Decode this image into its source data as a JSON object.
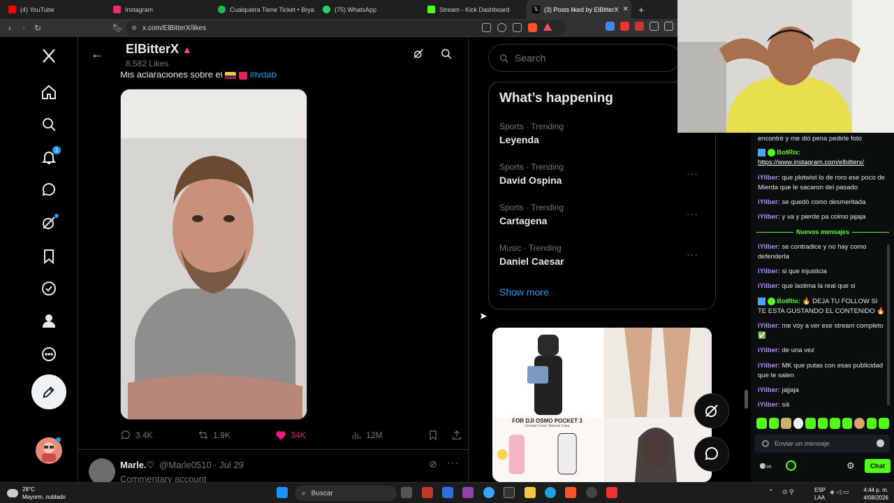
{
  "browser": {
    "tabs": [
      {
        "title": "(4) YouTube",
        "color": "#ff0000"
      },
      {
        "title": "Instagram",
        "color": "#e1306c"
      },
      {
        "title": "Cualquiera Tiene Ticket • Brya",
        "color": "#1db954"
      },
      {
        "title": "(75) WhatsApp",
        "color": "#25d366"
      },
      {
        "title": "Stream - Kick Dashboard",
        "color": "#53fc18"
      },
      {
        "title": "(3) Posts liked by ElBitterX",
        "color": "#ffffff"
      }
    ],
    "url": "x.com/ElBitterX/likes"
  },
  "profile_header": {
    "name": "ElBitterX",
    "likes": "8,582 Likes"
  },
  "nav": {
    "notifications_badge": "3"
  },
  "tweet": {
    "text": "Mis aclaraciones sobre el",
    "hashtag": "#lvdab",
    "replies": "3.4K",
    "reposts": "1.9K",
    "likes": "34K",
    "views": "12M"
  },
  "next_tweet": {
    "name": "Marle.♡",
    "handle": "@Marle0510 · Jul 29",
    "preview": "Commentary account"
  },
  "search": {
    "placeholder": "Search"
  },
  "trends": {
    "title": "What’s happening",
    "items": [
      {
        "category": "Sports · Trending",
        "name": "Leyenda"
      },
      {
        "category": "Sports · Trending",
        "name": "David Ospina"
      },
      {
        "category": "Sports · Trending",
        "name": "Cartagena"
      },
      {
        "category": "Music · Trending",
        "name": "Daniel Caesar"
      }
    ],
    "show_more": "Show more"
  },
  "ad": {
    "caption": "FOR DJI OSMO POCKET 3",
    "subcaption": "Circular Cover Silicone Case"
  },
  "chat": {
    "messages": [
      {
        "user": "",
        "text": "encontré y me dió pena pedirle foto",
        "type": "plain"
      },
      {
        "user": "BotRix:",
        "text": "https://www.instagram.com/elbitterx/",
        "type": "bot-link"
      },
      {
        "user": "iYilber:",
        "text": "que plotwist lo de roro ese poco de Mierda que le sacaron del pasado",
        "type": "user"
      },
      {
        "user": "iYilber:",
        "text": "se quedó como desmeritada",
        "type": "user"
      },
      {
        "user": "iYilber:",
        "text": "y va y pierde pa colmo jajaja",
        "type": "user"
      },
      {
        "user": "iYilber:",
        "text": "se contradice y no hay como defenderla",
        "type": "user"
      },
      {
        "user": "iYilber:",
        "text": "si que injusticia",
        "type": "user"
      },
      {
        "user": "iYilber:",
        "text": "que lastima la real que si",
        "type": "user"
      },
      {
        "user": "BotRix:",
        "text": "🔥 DEJA TU FOLLOW SI TE ESTA GUSTANDO EL CONTENIDO 🔥",
        "type": "bot"
      },
      {
        "user": "iYilber:",
        "text": "me voy a ver ese stream completo ✅",
        "type": "user"
      },
      {
        "user": "iYilber:",
        "text": "de una vez",
        "type": "user"
      },
      {
        "user": "iYilber:",
        "text": "MK que putas con esas publicidad que te salen",
        "type": "user"
      },
      {
        "user": "iYilber:",
        "text": "jajjaja",
        "type": "user"
      },
      {
        "user": "iYilber:",
        "text": "siii",
        "type": "user"
      }
    ],
    "new_messages_label": "Nuevos mensajes",
    "input_placeholder": "Enviar un mensaje",
    "chat_button": "Chat"
  },
  "taskbar": {
    "weather_temp": "28°C",
    "weather_desc": "Mayorm. nublado",
    "search_label": "Buscar",
    "lang_top": "ESP",
    "lang_bottom": "LAA",
    "time": "4:44 p. m.",
    "date": "4/08/2026"
  }
}
